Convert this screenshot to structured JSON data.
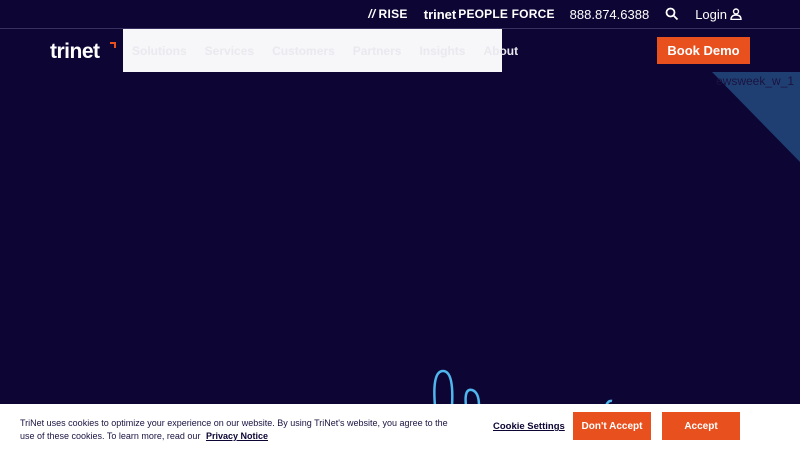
{
  "utility": {
    "rise": "RISE",
    "people_force_brand": "trinet",
    "people_force": "PEOPLE FORCE",
    "phone": "888.874.6388",
    "login": "Login"
  },
  "header": {
    "logo": "trinet",
    "nav": [
      "Solutions",
      "Services",
      "Customers",
      "Partners",
      "Insights",
      "About"
    ],
    "book_demo": "Book Demo"
  },
  "hero": {
    "broken_image_alt": "ewsweek_w_1"
  },
  "cookie": {
    "text": "TriNet uses cookies to optimize your experience on our website. By using TriNet's website, you agree to the use of these cookies. To learn more, read our",
    "privacy_link": "Privacy Notice",
    "settings": "Cookie Settings",
    "dont_accept": "Don't Accept",
    "accept": "Accept"
  },
  "colors": {
    "background": "#0d0533",
    "accent": "#e8501e",
    "triangle": "#1f3f73",
    "squiggle": "#4fb6ee"
  }
}
